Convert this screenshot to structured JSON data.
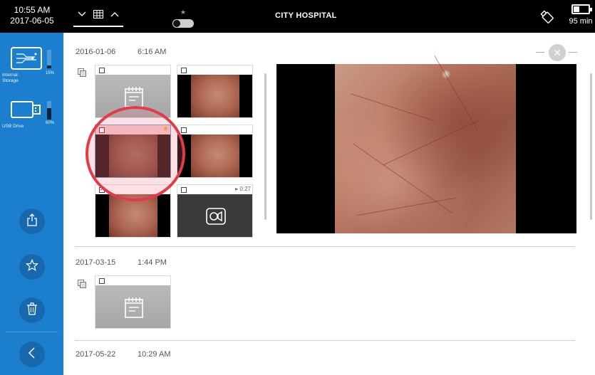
{
  "status": {
    "time": "10:55 AM",
    "date": "2017-06-05",
    "hospital": "CITY HOSPITAL",
    "battery_label": "95 min",
    "battery_level": 0.3
  },
  "sidebar": {
    "storage": [
      {
        "label": "Internal Storage",
        "percent": "15%",
        "level": 0.15,
        "icon": "internal-storage-icon"
      },
      {
        "label": "USB Drive",
        "percent": "60%",
        "level": 0.6,
        "icon": "usb-drive-icon"
      }
    ],
    "actions": [
      {
        "name": "export",
        "icon": "share-icon"
      },
      {
        "name": "favorite",
        "icon": "star-icon"
      },
      {
        "name": "delete",
        "icon": "trash-icon"
      }
    ],
    "back_icon": "chevron-left-icon"
  },
  "groups": [
    {
      "date": "2016-01-06",
      "time": "6:16 AM",
      "items": [
        {
          "type": "note",
          "checked": false,
          "starred": false
        },
        {
          "type": "image",
          "checked": false,
          "starred": false
        },
        {
          "type": "image",
          "checked": false,
          "starred": true,
          "selected": true
        },
        {
          "type": "image",
          "checked": false,
          "starred": false
        },
        {
          "type": "image",
          "checked": true,
          "starred": false
        },
        {
          "type": "video",
          "checked": false,
          "starred": false,
          "duration": "0:27"
        }
      ]
    },
    {
      "date": "2017-03-15",
      "time": "1:44 PM",
      "items": [
        {
          "type": "note",
          "checked": false,
          "starred": false
        }
      ]
    },
    {
      "date": "2017-05-22",
      "time": "10:29 AM",
      "items": []
    }
  ],
  "colors": {
    "sidebar": "#1c7fcd",
    "topbar": "#000000",
    "highlight": "#e03c4a",
    "star": "#f5a623"
  }
}
